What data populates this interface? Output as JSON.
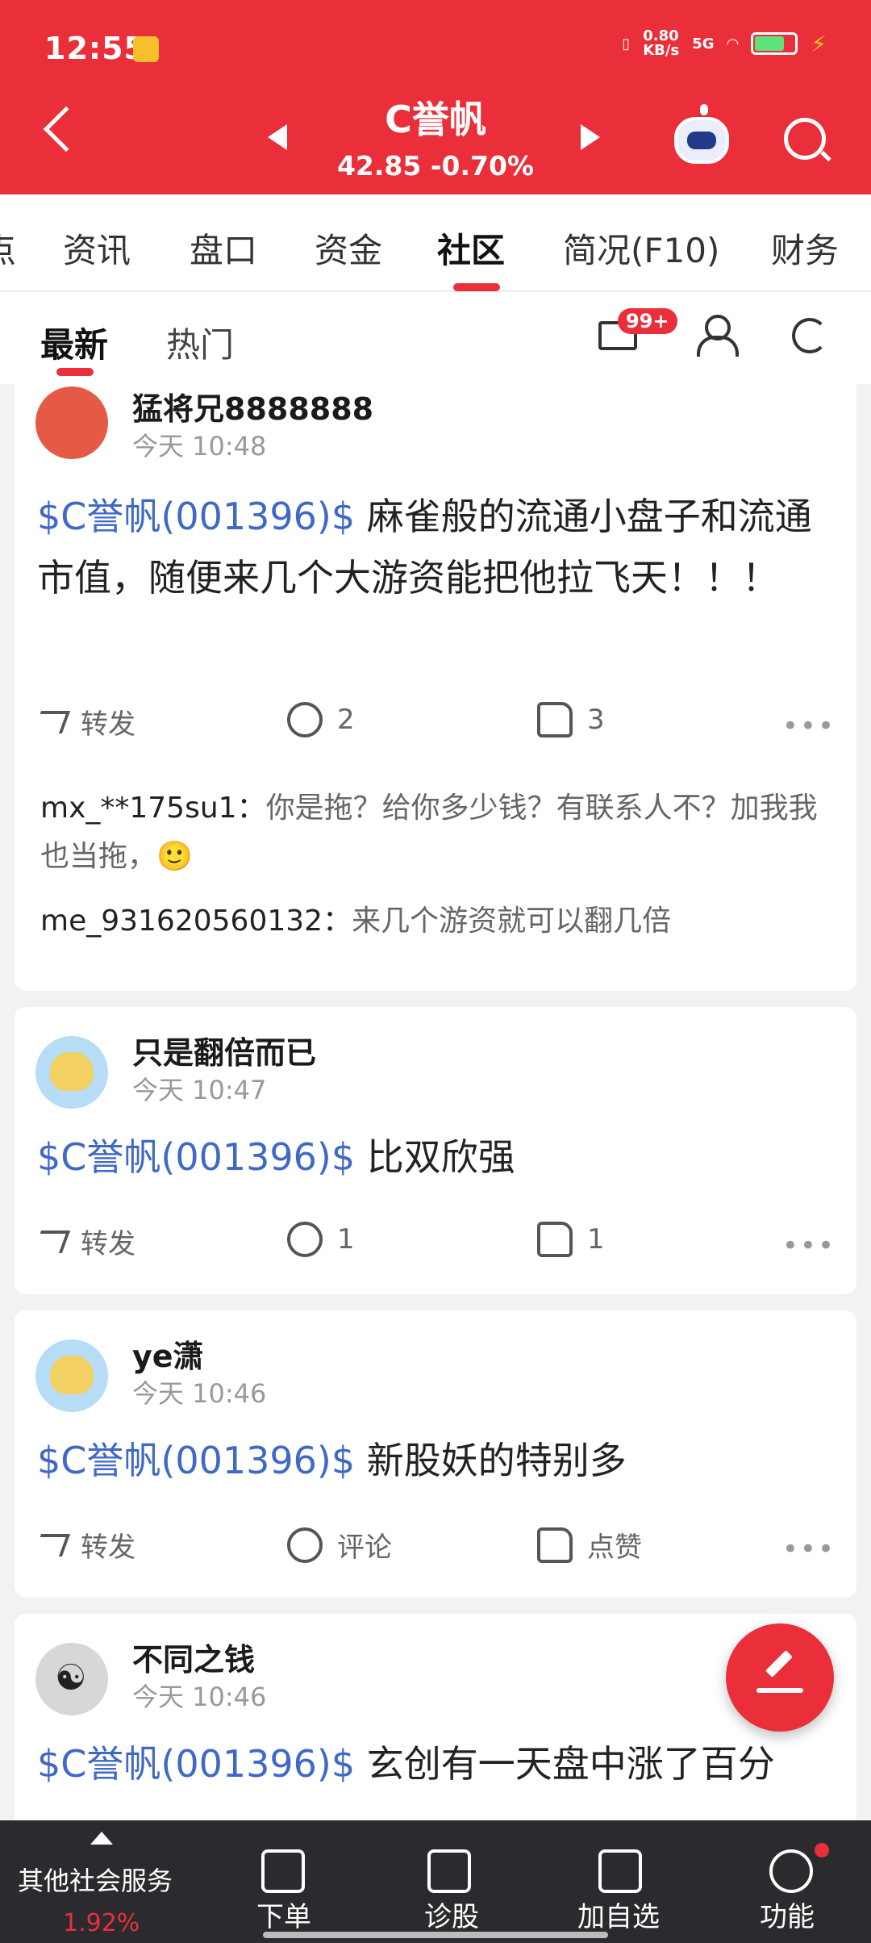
{
  "status_bar": {
    "time": "12:55",
    "network_speed": "0.80\nKB/s",
    "net": "5G"
  },
  "header": {
    "stock_name": "C誉帆",
    "stock_price": "42.85 -0.70%"
  },
  "tabs": [
    {
      "label": "点"
    },
    {
      "label": "资讯"
    },
    {
      "label": "盘口"
    },
    {
      "label": "资金"
    },
    {
      "label": "社区"
    },
    {
      "label": "简况(F10)"
    },
    {
      "label": "财务"
    }
  ],
  "subtabs": {
    "latest": "最新",
    "hot": "热门",
    "mail_badge": "99+"
  },
  "posts": [
    {
      "user": "猛将兄8888888",
      "time": "今天 10:48",
      "tag": "$C誉帆(001396)$",
      "content": "麻雀般的流通小盘子和流通市值，随便来几个大游资能把他拉飞天！！！",
      "share": "转发",
      "comment_count": "2",
      "like_count": "3",
      "comments": [
        {
          "user": "mx_**175su1：",
          "text": "你是拖？给你多少钱？有联系人不？加我我也当拖，🙂"
        },
        {
          "user": "me_931620560132：",
          "text": "来几个游资就可以翻几倍"
        }
      ]
    },
    {
      "user": "只是翻倍而已",
      "time": "今天 10:47",
      "tag": "$C誉帆(001396)$",
      "content": "比双欣强",
      "share": "转发",
      "comment_count": "1",
      "like_count": "1"
    },
    {
      "user": "ye潇",
      "time": "今天 10:46",
      "tag": "$C誉帆(001396)$",
      "content": "新股妖的特别多",
      "share": "转发",
      "comment_count": "评论",
      "like_count": "点赞"
    },
    {
      "user": "不同之钱",
      "time": "今天 10:46",
      "tag": "$C誉帆(001396)$",
      "content": "玄创有一天盘中涨了百分"
    }
  ],
  "bottom_bar": {
    "other_services": "其他社会服务",
    "other_pct": "1.92%",
    "order": "下单",
    "diagnose": "诊股",
    "add_watch": "加自选",
    "functions": "功能"
  },
  "colors": {
    "brand_red": "#ea2f3a",
    "link_blue": "#3f69c8"
  }
}
